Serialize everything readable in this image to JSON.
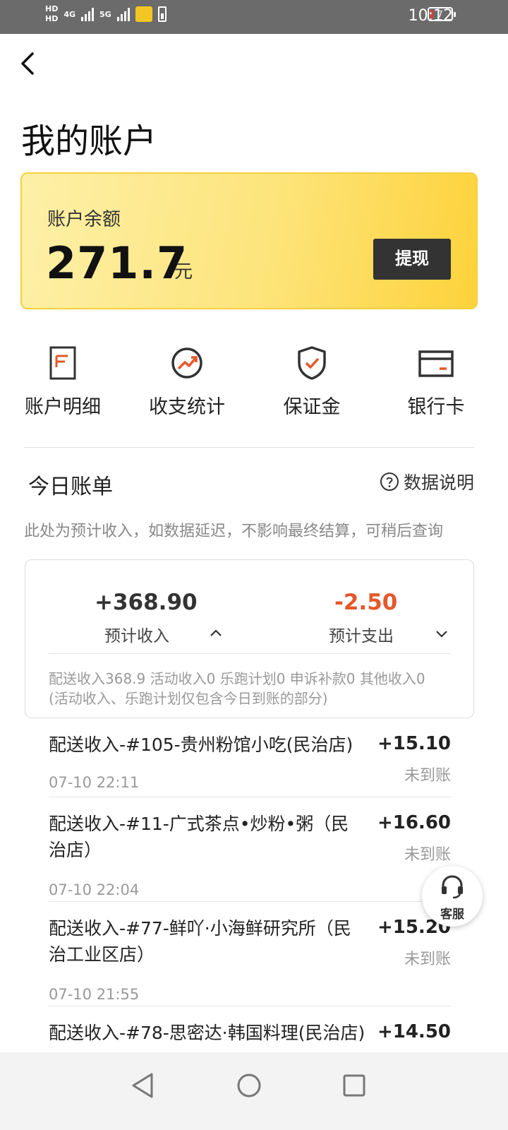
{
  "status_bar": {
    "hd1": "HD",
    "hd2": "HD",
    "network1": "4G",
    "network2": "5G",
    "battery_level": "7",
    "time": "10:12"
  },
  "header": {
    "back_icon": "chevron-left-icon",
    "title": "我的账户"
  },
  "balance": {
    "label": "账户余额",
    "amount": "271.7",
    "unit": "元",
    "withdraw_label": "提现",
    "colors": {
      "card_start": "#fdf0a8",
      "card_end": "#fdd23a",
      "button": "#333333"
    }
  },
  "quick_menu": [
    {
      "label": "账户明细",
      "icon": "document-icon"
    },
    {
      "label": "收支统计",
      "icon": "trend-chart-icon"
    },
    {
      "label": "保证金",
      "icon": "shield-check-icon"
    },
    {
      "label": "银行卡",
      "icon": "bank-card-icon"
    }
  ],
  "today_bill": {
    "title": "今日账单",
    "explain_label": "数据说明",
    "note": "此处为预计收入，如数据延迟，不影响最终结算，可稍后查询",
    "income_value": "+368.90",
    "income_label": "预计收入",
    "expense_value": "-2.50",
    "expense_label": "预计支出",
    "detail_line1": "配送收入368.9 活动收入0 乐跑计划0 申诉补款0 其他收入0",
    "detail_line2": "(活动收入、乐跑计划仅包含今日到账的部分)",
    "accent_color": "#e4582b"
  },
  "transactions": [
    {
      "title": "配送收入-#105-贵州粉馆小吃(民治店)",
      "time": "07-10 22:11",
      "amount": "+15.10",
      "status": "未到账"
    },
    {
      "title": "配送收入-#11-广式茶点•炒粉•粥（民治店）",
      "time": "07-10 22:04",
      "amount": "+16.60",
      "status": "未到账"
    },
    {
      "title": "配送收入-#77-鲜吖·小海鲜研究所（民治工业区店）",
      "time": "07-10 21:55",
      "amount": "+15.20",
      "status": "未到账"
    },
    {
      "title": "配送收入-#78-思密达·韩国料理(民治店)",
      "time": "",
      "amount": "+14.50",
      "status": ""
    }
  ],
  "service": {
    "label": "客服",
    "icon": "headset-icon"
  },
  "nav": {
    "icons": [
      "back-triangle-icon",
      "home-circle-icon",
      "recents-square-icon"
    ]
  }
}
